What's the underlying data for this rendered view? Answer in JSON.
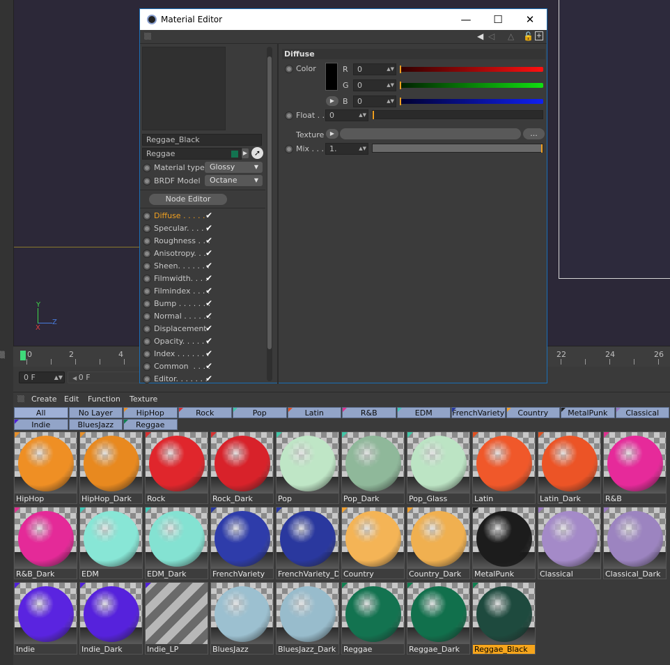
{
  "viewport": {
    "axis_labels": {
      "y": "Y",
      "z": "Z",
      "x": "X"
    }
  },
  "timeline": {
    "ticks": [
      {
        "label": "0"
      },
      {
        "label": "2"
      },
      {
        "label": "4"
      },
      {
        "label": "22"
      },
      {
        "label": "24"
      },
      {
        "label": "26"
      }
    ],
    "start_field": "0 F",
    "current_field": "0 F"
  },
  "material_editor": {
    "title": "Material Editor",
    "material_name": "Reggae_Black",
    "layer_name": "Reggae",
    "material_type_label": "Material type",
    "material_type_value": "Glossy",
    "brdf_label": "BRDF Model",
    "brdf_value": "Octane",
    "node_editor_label": "Node Editor",
    "channels": [
      {
        "label": "Diffuse . . . . .",
        "active": true
      },
      {
        "label": "Specular. . . . .",
        "active": false
      },
      {
        "label": "Roughness . . .",
        "active": false
      },
      {
        "label": "Anisotropy. . .",
        "active": false
      },
      {
        "label": "Sheen. . . . . . .",
        "active": false
      },
      {
        "label": "Filmwidth. . . .",
        "active": false
      },
      {
        "label": "Filmindex . . . .",
        "active": false
      },
      {
        "label": "Bump . . . . . . .",
        "active": false
      },
      {
        "label": "Normal . . . . . .",
        "active": false
      },
      {
        "label": "Displacement",
        "active": false
      },
      {
        "label": "Opacity. . . . . .",
        "active": false
      },
      {
        "label": "Index . . . . . . .",
        "active": false
      },
      {
        "label": "Common  . . . .",
        "active": false
      },
      {
        "label": "Editor. . . . . . .",
        "active": false
      }
    ],
    "diffuse": {
      "section_title": "Diffuse",
      "color_label": "Color",
      "r_label": "R",
      "r_value": "0",
      "g_label": "G",
      "g_value": "0",
      "b_label": "B",
      "b_value": "0",
      "float_label": "Float . .",
      "float_value": "0",
      "texture_label": "Texture",
      "texture_more": "...",
      "mix_label": "Mix . . .",
      "mix_value": "1.",
      "swatch_color": "#000000"
    }
  },
  "material_manager": {
    "menu": [
      "Create",
      "Edit",
      "Function",
      "Texture"
    ],
    "layers": [
      {
        "label": "All",
        "color": ""
      },
      {
        "label": "No Layer",
        "color": ""
      },
      {
        "label": "HipHop",
        "color": "#e8902a"
      },
      {
        "label": "Rock",
        "color": "#d83030"
      },
      {
        "label": "Pop",
        "color": "#40c8a8"
      },
      {
        "label": "Latin",
        "color": "#e05020"
      },
      {
        "label": "R&B",
        "color": "#e03090"
      },
      {
        "label": "EDM",
        "color": "#40c8b8"
      },
      {
        "label": "FrenchVariety",
        "color": "#2838a0"
      },
      {
        "label": "Country",
        "color": "#f0a030"
      },
      {
        "label": "MetalPunk",
        "color": "#202020"
      },
      {
        "label": "Classical",
        "color": "#9878c0"
      },
      {
        "label": "Indie",
        "color": "#5020d8"
      },
      {
        "label": "BluesJazz",
        "color": ""
      },
      {
        "label": "Reggae",
        "color": "#108050"
      }
    ],
    "materials": [
      {
        "name": "HipHop",
        "color": "#ef8f24",
        "tag": "#e8902a"
      },
      {
        "name": "HipHop_Dark",
        "color": "#e8891f",
        "tag": "#e8902a"
      },
      {
        "name": "Rock",
        "color": "#e0262c",
        "tag": "#d83030"
      },
      {
        "name": "Rock_Dark",
        "color": "#d8222a",
        "tag": "#d83030"
      },
      {
        "name": "Pop",
        "color": "#bfe6c6",
        "tag": "#40c8a8"
      },
      {
        "name": "Pop_Dark",
        "color": "#8fb89a",
        "tag": "#40c8a8"
      },
      {
        "name": "Pop_Glass",
        "color": "#bce4c4",
        "tag": "#40c8a8"
      },
      {
        "name": "Latin",
        "color": "#f0582a",
        "tag": "#e05020"
      },
      {
        "name": "Latin_Dark",
        "color": "#ec5426",
        "tag": "#e05020"
      },
      {
        "name": "R&B",
        "color": "#e62a9a",
        "tag": "#e03090"
      },
      {
        "name": "R&B_Dark",
        "color": "#e42a98",
        "tag": "#e03090"
      },
      {
        "name": "EDM",
        "color": "#88e6d6",
        "tag": "#40c8b8"
      },
      {
        "name": "EDM_Dark",
        "color": "#84e2d2",
        "tag": "#40c8b8"
      },
      {
        "name": "FrenchVariety",
        "color": "#2e3caa",
        "tag": "#2838a0"
      },
      {
        "name": "FrenchVariety_Dark",
        "color": "#2a389e",
        "tag": "#2838a0"
      },
      {
        "name": "Country",
        "color": "#f4b456",
        "tag": "#f0a030"
      },
      {
        "name": "Country_Dark",
        "color": "#f0b050",
        "tag": "#f0a030"
      },
      {
        "name": "MetalPunk",
        "color": "#1c1c1c",
        "tag": "#202020"
      },
      {
        "name": "Classical",
        "color": "#a48ac8",
        "tag": "#9878c0"
      },
      {
        "name": "Classical_Dark",
        "color": "#9c84c0",
        "tag": "#9878c0"
      },
      {
        "name": "Indie",
        "color": "#5a24e0",
        "tag": "#5020d8"
      },
      {
        "name": "Indie_Dark",
        "color": "#5622dc",
        "tag": "#5020d8"
      },
      {
        "name": "Indie_LP",
        "color": "",
        "tag": "#5020d8"
      },
      {
        "name": "BluesJazz",
        "color": "#9cc0d0",
        "tag": ""
      },
      {
        "name": "BluesJazz_Dark",
        "color": "#98bccc",
        "tag": ""
      },
      {
        "name": "Reggae",
        "color": "#137350",
        "tag": "#108050"
      },
      {
        "name": "Reggae_Dark",
        "color": "#11704c",
        "tag": "#108050"
      },
      {
        "name": "Reggae_Black",
        "color": "#1e4a3e",
        "tag": "#108050",
        "selected": true
      }
    ]
  }
}
